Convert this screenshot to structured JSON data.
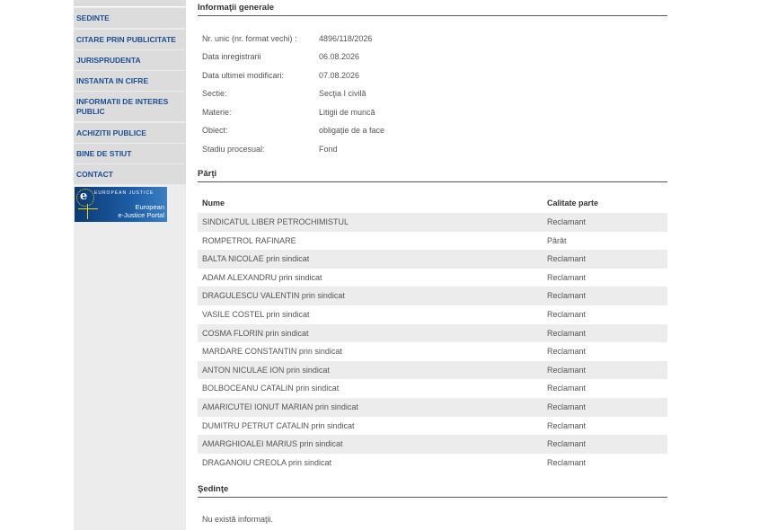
{
  "sidebar": {
    "items": [
      {
        "label": "SEDINTE"
      },
      {
        "label": "CITARE PRIN PUBLICITATE"
      },
      {
        "label": "JURISPRUDENTA"
      },
      {
        "label": "INSTANTA IN CIFRE"
      },
      {
        "label": "INFORMATII DE INTERES PUBLIC"
      },
      {
        "label": "ACHIZITII PUBLICE"
      },
      {
        "label": "BINE DE STIUT"
      },
      {
        "label": "CONTACT"
      }
    ],
    "banner": {
      "eu_text": "EUROPEAN JUSTICE",
      "portal_line1": "European",
      "portal_line2": "e-Justice Portal"
    }
  },
  "general": {
    "title": "Informaţii generale",
    "rows": [
      {
        "label": "Nr. unic (nr. format vechi) :",
        "value": "4896/118/2026"
      },
      {
        "label": "Data inregistrarii",
        "value": "06.08.2026"
      },
      {
        "label": "Data ultimei modificari:",
        "value": "07.08.2026"
      },
      {
        "label": "Sectie:",
        "value": "Secţia I civilă"
      },
      {
        "label": "Materie:",
        "value": "Litigii de muncă"
      },
      {
        "label": "Obiect:",
        "value": "obligaţie de a face"
      },
      {
        "label": "Stadiu procesual:",
        "value": "Fond"
      }
    ]
  },
  "parti": {
    "title": "Părţi",
    "header_name": "Nume",
    "header_role": "Calitate parte",
    "rows": [
      {
        "name": "SINDICATUL LIBER PETROCHIMISTUL",
        "role": "Reclamant"
      },
      {
        "name": "ROMPETROL RAFINARE",
        "role": "Pârât"
      },
      {
        "name": "BALTA NICOLAE prin sindicat",
        "role": "Reclamant"
      },
      {
        "name": "ADAM ALEXANDRU prin sindicat",
        "role": "Reclamant"
      },
      {
        "name": "DRAGULESCU VALENTIN prin sindicat",
        "role": "Reclamant"
      },
      {
        "name": "VASILE COSTEL prin sindicat",
        "role": "Reclamant"
      },
      {
        "name": "COSMA FLORIN prin sindicat",
        "role": "Reclamant"
      },
      {
        "name": "MARDARE CONSTANTIN prin sindicat",
        "role": "Reclamant"
      },
      {
        "name": "ANTON NICULAE ION prin sindicat",
        "role": "Reclamant"
      },
      {
        "name": "BOLBOCEANU CATALIN prin sindicat",
        "role": "Reclamant"
      },
      {
        "name": "AMARICUTEI IONUT MARIAN prin sindicat",
        "role": "Reclamant"
      },
      {
        "name": "DUMITRU PETRUT CATALIN prin sindicat",
        "role": "Reclamant"
      },
      {
        "name": "AMARGHIOALEI MARIUS prin sindicat",
        "role": "Reclamant"
      },
      {
        "name": "DRAGANOIU CREOLA prin sindicat",
        "role": "Reclamant"
      }
    ]
  },
  "sedinte": {
    "title": "Şedinţe",
    "empty_text": "Nu există informaţii."
  }
}
